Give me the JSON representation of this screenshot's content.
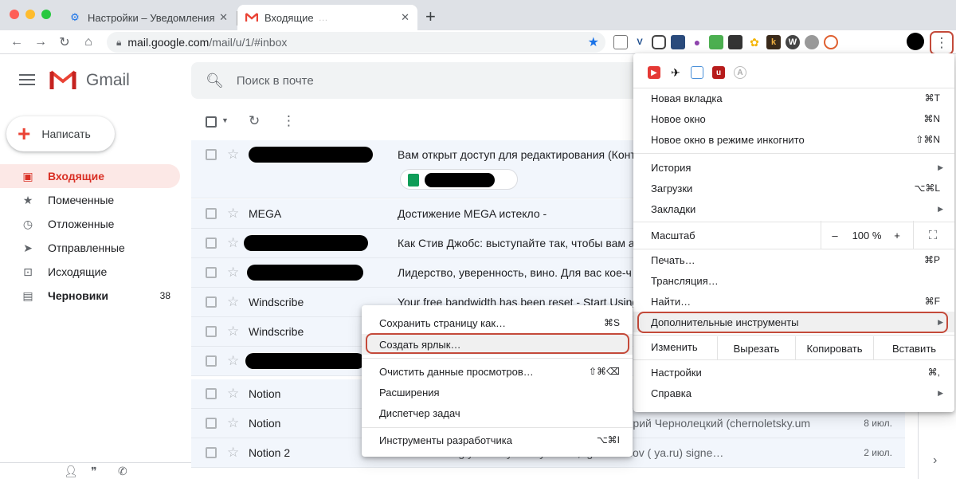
{
  "browser": {
    "tabs": [
      {
        "title": "Настройки – Уведомления",
        "close": "✕"
      },
      {
        "title": "Входящие",
        "close": "✕"
      }
    ],
    "new_tab": "+",
    "url_host": "mail.google.com",
    "url_path": "/mail/u/1/#inbox"
  },
  "gmail": {
    "brand": "Gmail",
    "search_placeholder": "Поиск в почте",
    "compose_label": "Написать",
    "sidebar": [
      {
        "label": "Входящие",
        "icon": "inbox-icon",
        "active": true
      },
      {
        "label": "Помеченные",
        "icon": "star-icon"
      },
      {
        "label": "Отложенные",
        "icon": "clock-icon"
      },
      {
        "label": "Отправленные",
        "icon": "send-icon"
      },
      {
        "label": "Исходящие",
        "icon": "outbox-icon"
      },
      {
        "label": "Черновики",
        "icon": "draft-icon",
        "count": "38"
      }
    ],
    "emails": [
      {
        "sender": "",
        "subject": "Вам открыт доступ для редактирования (Конт",
        "date": ""
      },
      {
        "sender": "MEGA",
        "subject": "Достижение MEGA истекло -",
        "date": ""
      },
      {
        "sender": "",
        "subject": "Как Стив Джобс: выступайте так, чтобы вам а",
        "date": ""
      },
      {
        "sender": "",
        "subject": "Лидерство, уверенность, вино. Для вас кое-ч",
        "date": ""
      },
      {
        "sender": "Windscribe",
        "subject": "Your free bandwidth has been reset - Start Using",
        "date": ""
      },
      {
        "sender": "Windscribe",
        "subject": "",
        "date": ""
      },
      {
        "sender": "",
        "subject": "",
        "date": ""
      },
      {
        "sender": "Notion",
        "subject": "",
        "date": ""
      },
      {
        "sender": "Notion",
        "subject": "трий Чернолецкий (chernoletsky.um",
        "date": "8 июл."
      },
      {
        "sender": "Notion 2",
        "subject": "…is coming your way! - Hey Artem, Igor denisov (         ya.ru) signe…",
        "date": "2 июл."
      }
    ]
  },
  "chrome_menu": {
    "items": [
      {
        "label": "Новая вкладка",
        "shortcut": "⌘T"
      },
      {
        "label": "Новое окно",
        "shortcut": "⌘N"
      },
      {
        "label": "Новое окно в режиме инкогнито",
        "shortcut": "⇧⌘N"
      },
      {
        "label": "История",
        "shortcut": ""
      },
      {
        "label": "Загрузки",
        "shortcut": "⌥⌘L"
      },
      {
        "label": "Закладки",
        "shortcut": ""
      },
      {
        "label": "Масштаб",
        "shortcut": ""
      },
      {
        "label": "Печать…",
        "shortcut": "⌘P"
      },
      {
        "label": "Трансляция…",
        "shortcut": ""
      },
      {
        "label": "Найти…",
        "shortcut": "⌘F"
      },
      {
        "label": "Дополнительные инструменты",
        "shortcut": ""
      },
      {
        "label": "Настройки",
        "shortcut": "⌘,"
      },
      {
        "label": "Справка",
        "shortcut": ""
      }
    ],
    "zoom": {
      "minus": "–",
      "value": "100 %",
      "plus": "+",
      "fullscreen": "⛶"
    },
    "edit": {
      "label": "Изменить",
      "cut": "Вырезать",
      "copy": "Копировать",
      "paste": "Вставить"
    }
  },
  "more_tools_menu": {
    "items": [
      {
        "label": "Сохранить страницу как…",
        "shortcut": "⌘S"
      },
      {
        "label": "Создать ярлык…",
        "shortcut": ""
      },
      {
        "label": "Очистить данные просмотров…",
        "shortcut": "⇧⌘⌫"
      },
      {
        "label": "Расширения",
        "shortcut": ""
      },
      {
        "label": "Диспетчер задач",
        "shortcut": ""
      },
      {
        "label": "Инструменты разработчика",
        "shortcut": "⌥⌘I"
      }
    ]
  }
}
